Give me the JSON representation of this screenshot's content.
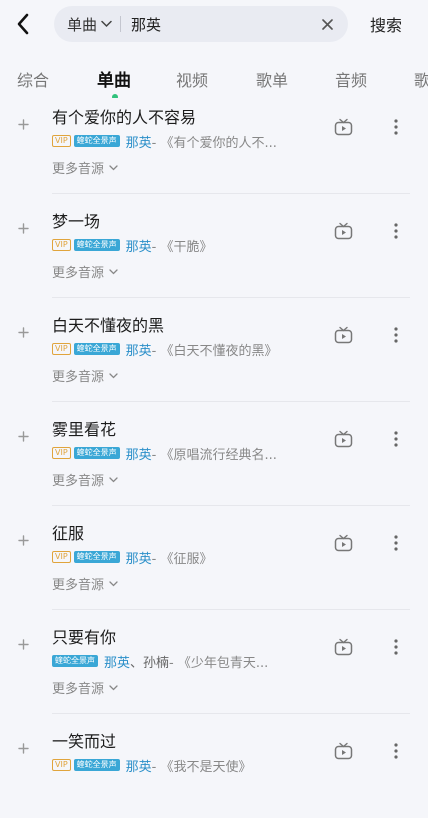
{
  "search": {
    "type_label": "单曲",
    "value": "那英",
    "button_label": "搜索"
  },
  "tabs": [
    {
      "label": "综合"
    },
    {
      "label": "单曲"
    },
    {
      "label": "视频"
    },
    {
      "label": "歌单"
    },
    {
      "label": "音频"
    },
    {
      "label": "歌"
    }
  ],
  "active_tab": "单曲",
  "badges": {
    "vip": "VIP",
    "hq": "蝰蛇全景声"
  },
  "more_sources_label": "更多音源",
  "songs": [
    {
      "title": "有个爱你的人不容易",
      "vip": true,
      "artist": "那英",
      "extra_artist": "",
      "album": " - 《有个爱你的人不..."
    },
    {
      "title": "梦一场",
      "vip": true,
      "artist": "那英",
      "extra_artist": "",
      "album": " - 《干脆》"
    },
    {
      "title": "白天不懂夜的黑",
      "vip": true,
      "artist": "那英",
      "extra_artist": "",
      "album": " - 《白天不懂夜的黑》"
    },
    {
      "title": "雾里看花",
      "vip": true,
      "artist": "那英",
      "extra_artist": "",
      "album": " - 《原唱流行经典名..."
    },
    {
      "title": "征服",
      "vip": true,
      "artist": "那英",
      "extra_artist": "",
      "album": " - 《征服》"
    },
    {
      "title": "只要有你",
      "vip": false,
      "artist": "那英",
      "extra_artist": "、孙楠",
      "album": " - 《少年包青天..."
    },
    {
      "title": "一笑而过",
      "vip": true,
      "artist": "那英",
      "extra_artist": "",
      "album": " - 《我不是天使》"
    }
  ],
  "colors": {
    "accent": "#31c27c",
    "artist": "#2a8fc9",
    "vip": "#e0a43c",
    "hq_badge": "#3aa7d6"
  },
  "icons": [
    "back-arrow-icon",
    "chevron-down-icon",
    "clear-icon",
    "add-icon",
    "mv-icon",
    "more-vertical-icon"
  ]
}
